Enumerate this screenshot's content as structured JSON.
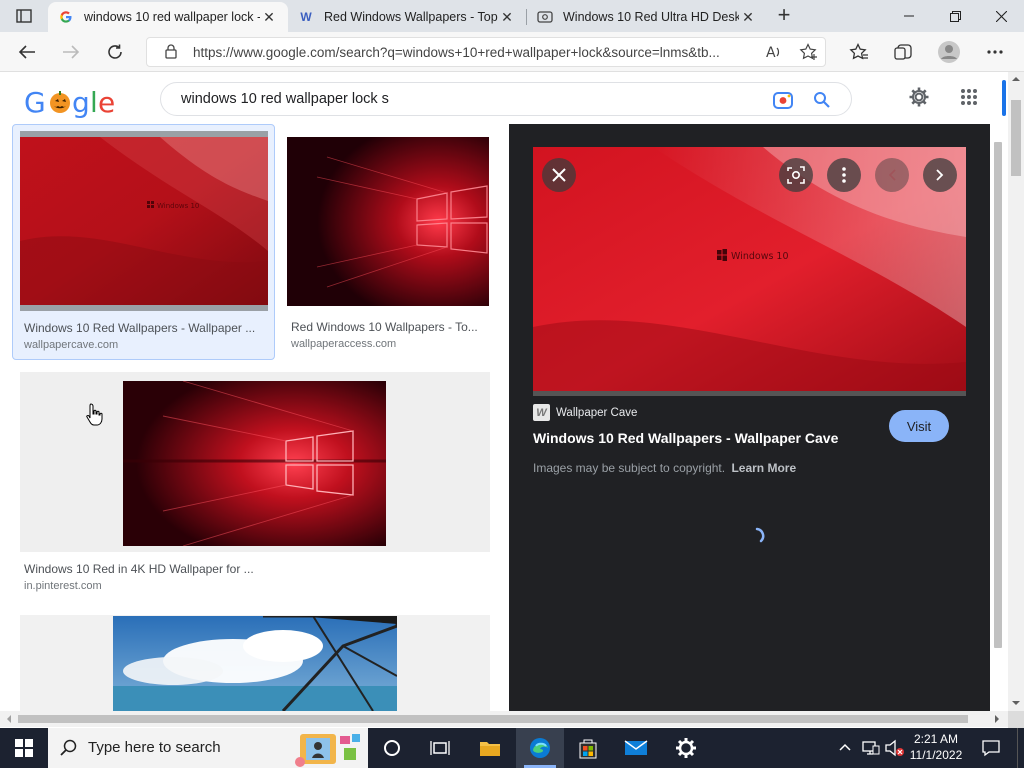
{
  "browser": {
    "tabs": [
      {
        "title": "windows 10 red wallpaper lock -",
        "active": true
      },
      {
        "title": "Red Windows Wallpapers - Top F",
        "active": false
      },
      {
        "title": "Windows 10 Red Ultra HD Deskt",
        "active": false
      }
    ],
    "url": "https://www.google.com/search?q=windows+10+red+wallpaper+lock&source=lnms&tb...",
    "new_tab": "+"
  },
  "google": {
    "logo_text": "Google",
    "query": "windows 10 red wallpaper lock s"
  },
  "results": [
    {
      "title": "Windows 10 Red Wallpapers - Wallpaper ...",
      "source": "wallpapercave.com",
      "selected": true,
      "thumb_text": "Windows 10"
    },
    {
      "title": "Red Windows 10 Wallpapers - To...",
      "source": "wallpaperaccess.com",
      "selected": false
    },
    {
      "title": "Windows 10 Red in 4K HD Wallpaper for ...",
      "source": "in.pinterest.com",
      "selected": false
    }
  ],
  "preview": {
    "image_text": "Windows 10",
    "site": "Wallpaper Cave",
    "site_icon": "W",
    "title": "Windows 10 Red Wallpapers - Wallpaper Cave",
    "copyright": "Images may be subject to copyright.",
    "learn_more": "Learn More",
    "visit": "Visit"
  },
  "taskbar": {
    "search_placeholder": "Type here to search",
    "time": "2:21 AM",
    "date": "11/1/2022"
  }
}
